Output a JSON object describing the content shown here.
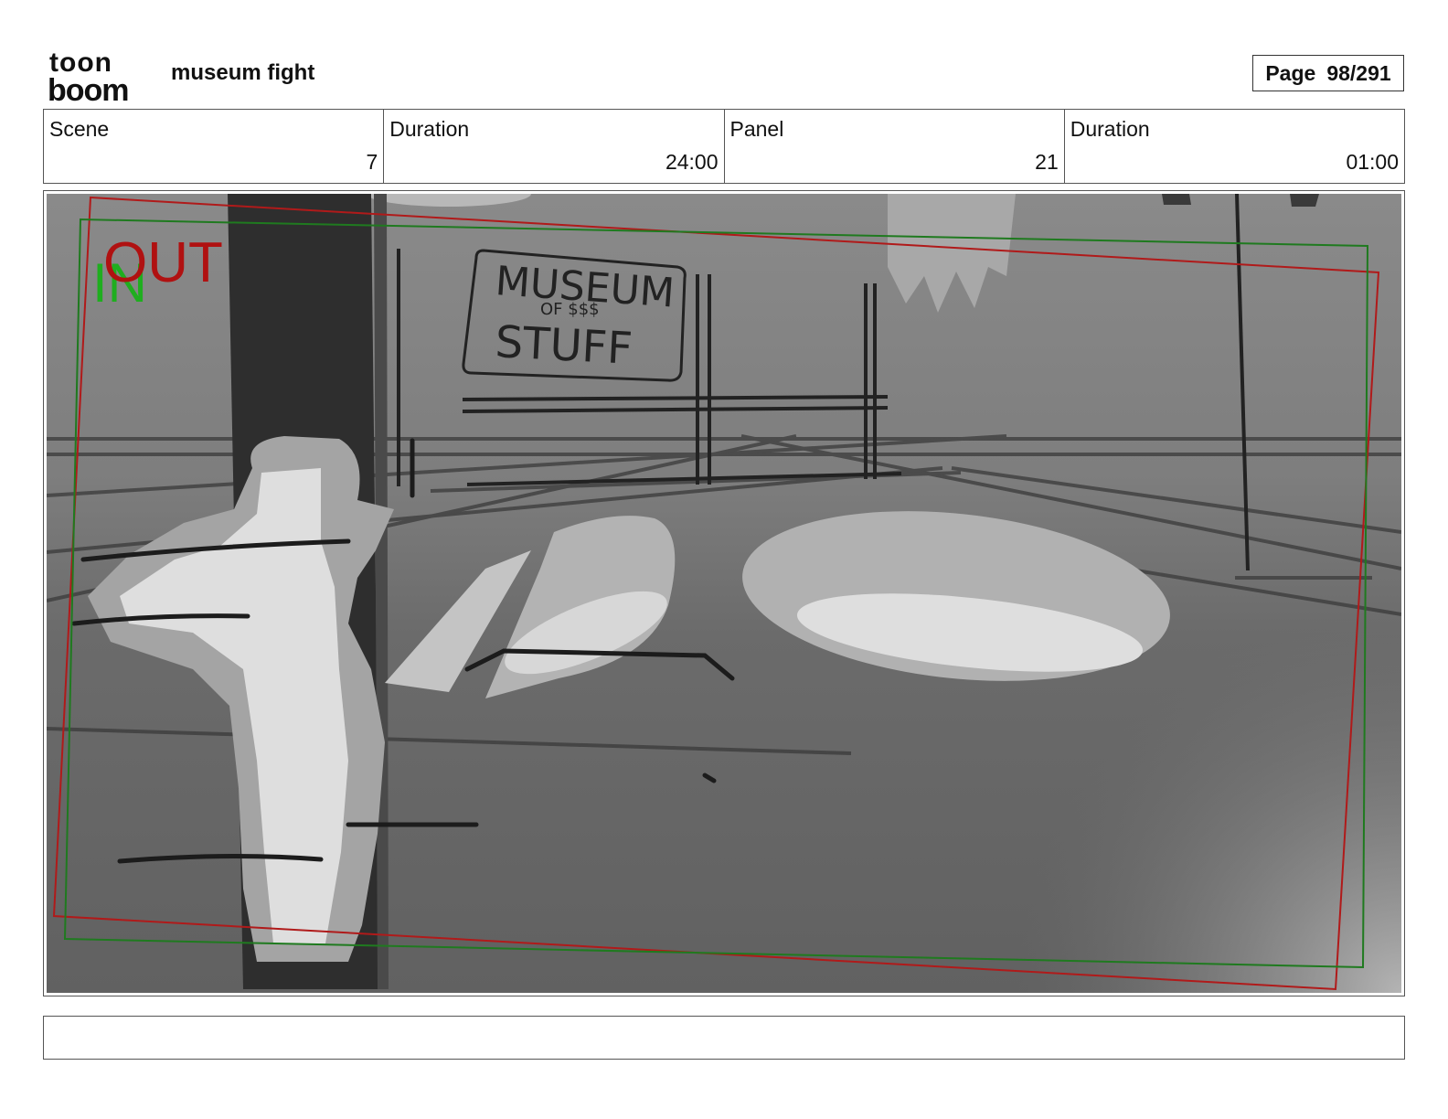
{
  "header": {
    "logo": {
      "line1": "toon",
      "line2": "boom"
    },
    "project_title": "museum fight",
    "page": {
      "label": "Page",
      "value": "98/291"
    }
  },
  "info": [
    {
      "label": "Scene",
      "value": "7"
    },
    {
      "label": "Duration",
      "value": "24:00"
    },
    {
      "label": "Panel",
      "value": "21"
    },
    {
      "label": "Duration",
      "value": "01:00"
    }
  ],
  "panel": {
    "markers": {
      "in": "IN",
      "out": "OUT"
    },
    "sign": {
      "line1": "MUSEUM",
      "line2": "OF $$$",
      "line3": "STUFF"
    },
    "colors": {
      "in": "#1fae1f",
      "out": "#b01111",
      "in_frame": "#1f7a1f",
      "out_frame": "#b01a1a"
    }
  },
  "notes": {
    "text": ""
  }
}
